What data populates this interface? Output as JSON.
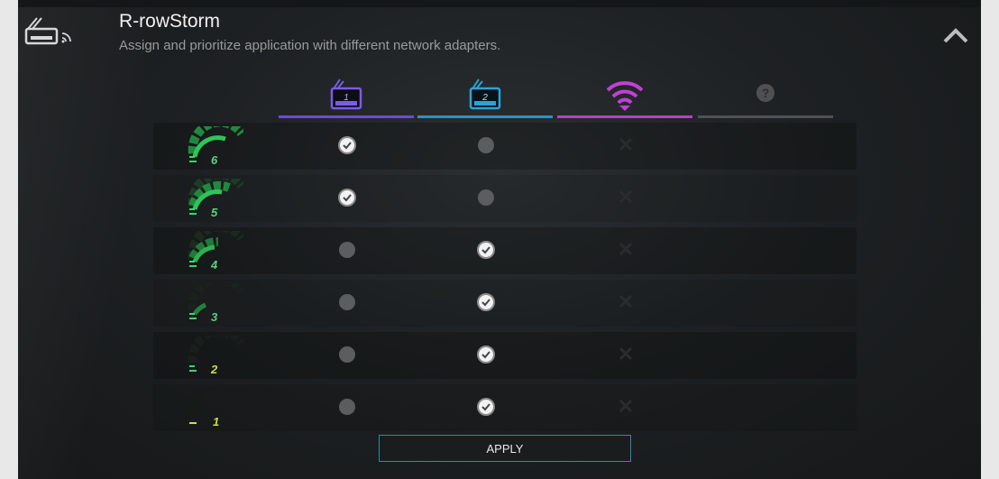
{
  "header": {
    "title": "R-rowStorm",
    "subtitle": "Assign and prioritize application with different network adapters."
  },
  "adapters": [
    {
      "icon": "ethernet-1-icon",
      "label": "1",
      "color": "#6a4cd8"
    },
    {
      "icon": "ethernet-2-icon",
      "label": "2",
      "color": "#2a93c9"
    },
    {
      "icon": "wifi-icon",
      "label": "",
      "color": "#b73fcb"
    },
    {
      "icon": "help-icon",
      "label": "?",
      "color": "#5a5a5a"
    }
  ],
  "rows": [
    {
      "level": "6",
      "states": [
        "checked",
        "unchecked",
        "disabled"
      ]
    },
    {
      "level": "5",
      "states": [
        "checked",
        "unchecked",
        "disabled"
      ]
    },
    {
      "level": "4",
      "states": [
        "unchecked",
        "checked",
        "disabled"
      ]
    },
    {
      "level": "3",
      "states": [
        "unchecked",
        "checked",
        "disabled"
      ]
    },
    {
      "level": "2",
      "states": [
        "unchecked",
        "checked",
        "disabled"
      ]
    },
    {
      "level": "1",
      "states": [
        "unchecked",
        "checked",
        "disabled"
      ]
    }
  ],
  "apply_label": "APPLY",
  "colors": {
    "accent_green": "#2ea84a",
    "level_text": "#c8e040",
    "apply_border": "#2f8aa5"
  }
}
